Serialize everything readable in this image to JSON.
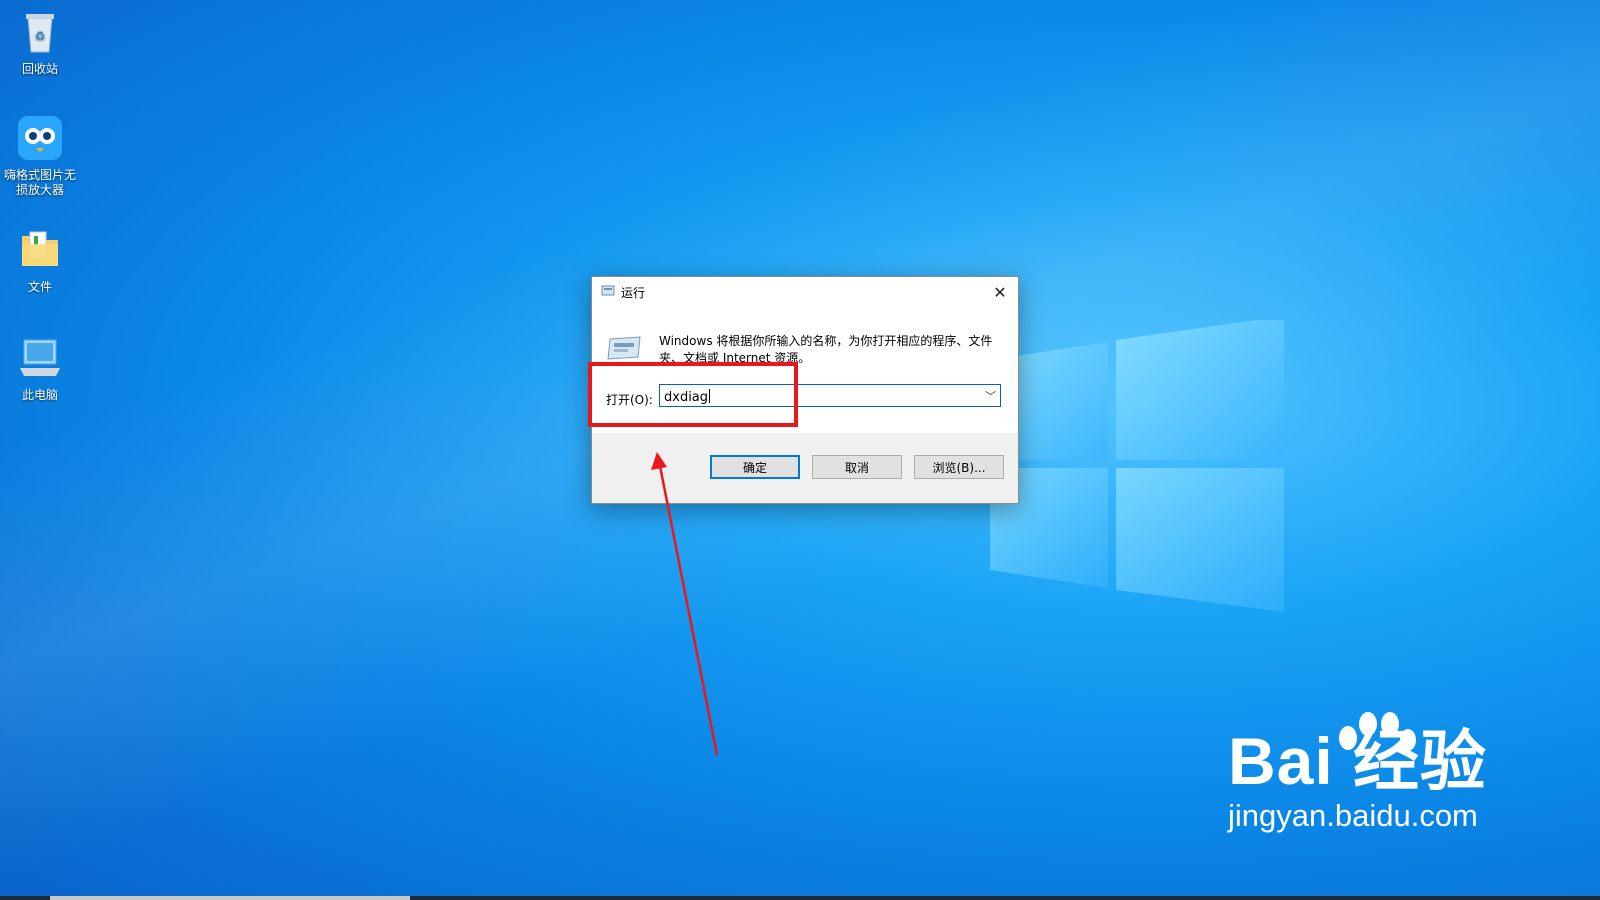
{
  "desktop": {
    "icons": [
      {
        "label": "回收站"
      },
      {
        "label": "嗨格式图片无损放大器"
      },
      {
        "label": "文件"
      },
      {
        "label": "此电脑"
      }
    ]
  },
  "dialog": {
    "title": "运行",
    "description": "Windows 将根据你所输入的名称，为你打开相应的程序、文件夹、文档或 Internet 资源。",
    "open_label": "打开(O):",
    "open_value": "dxdiag",
    "ok_label": "确定",
    "cancel_label": "取消",
    "browse_label": "浏览(B)..."
  },
  "watermark": {
    "brand": "Bai  经验",
    "url": "jingyan.baidu.com"
  },
  "colors": {
    "annotation": "#e8181e",
    "focus": "#0078d7"
  }
}
